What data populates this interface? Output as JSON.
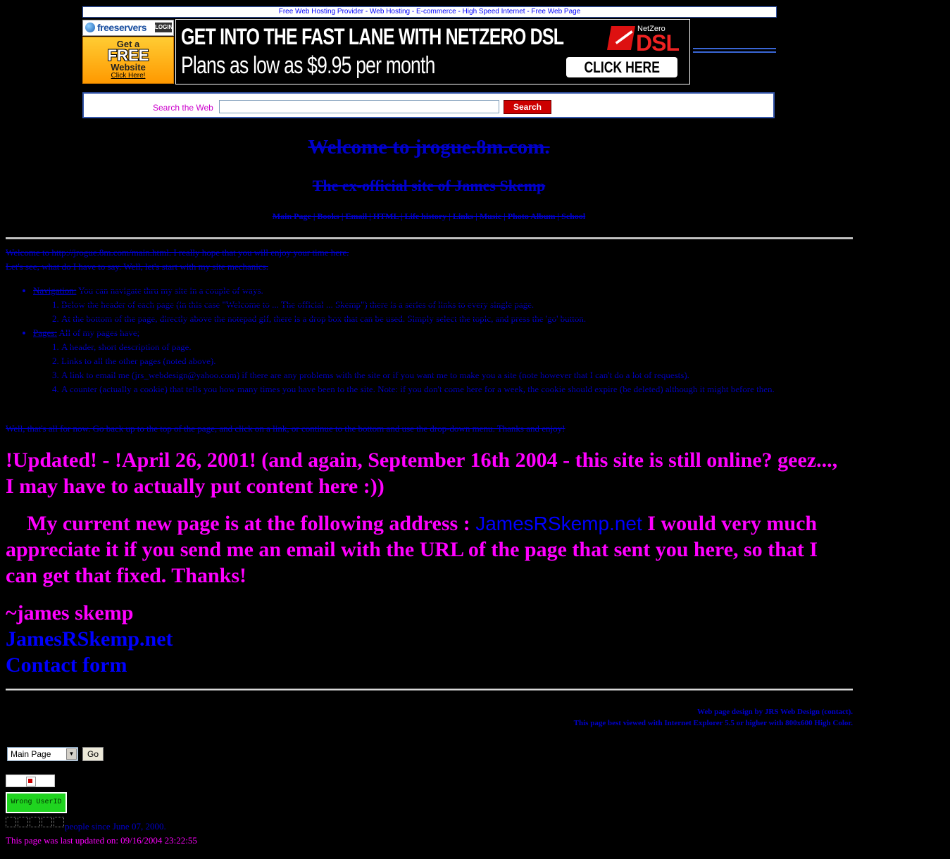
{
  "host_banner": {
    "links": [
      "Free Web Hosting Provider",
      "Web Hosting",
      "E-commerce",
      "High Speed Internet",
      "Free Web Page"
    ],
    "logo_name": "freeservers",
    "login_label": "LOGIN",
    "free_line1": "Get a",
    "free_line2": "FREE",
    "free_line3": "Website",
    "free_line4": "Click Here!"
  },
  "ad": {
    "line1": "GET INTO THE FAST LANE WITH NETZERO DSL",
    "line2": "Plans as low as $9.95 per month",
    "brand_small": "NetZero",
    "brand_big": "DSL",
    "cta": "CLICK HERE"
  },
  "search": {
    "label": "Search the Web",
    "placeholder": "",
    "button": "Search"
  },
  "header": {
    "title": "Welcome to jrogue.8m.com.",
    "subtitle": "The ex-official site of James Skemp"
  },
  "nav": [
    "Main Page",
    "Books",
    "Email",
    "HTML",
    "Life history",
    "Links",
    "Music",
    "Photo Album",
    "School"
  ],
  "intro": {
    "line1": "Welcome to http://jrogue.8m.com/main.html. I really hope that you will enjoy your time here.",
    "line2": "Let's see, what do I have to say. Well, let's start with my site mechanics."
  },
  "navigation_section": {
    "label": "Navigation:",
    "text": " You can navigate thru my site in a couple of ways.",
    "items": [
      "Below the header of each page (in this case \"Welcome to ... The official ... Skemp\") there is a series of links to every single page.",
      "At the bottom of the page, directly above the notepad gif, there is a drop box that can be used. Simply select the topic, and press the 'go' button."
    ]
  },
  "pages_section": {
    "label": "Pages:",
    "text": " All of my pages have;",
    "items": [
      "A header, short description of page.",
      "Links to all the other pages (noted above).",
      "A link to email me (jrs_webdesign@yahoo.com) if there are any problems with the site or if you want me to make you a site (note however that I can't do a lot of requests).",
      "A counter (actually a cookie) that tells you how many times you have been to the site. Note: if you don't come here for a week, the cookie should expire (be deleted) although it might before then."
    ]
  },
  "outro": "Well, that's all for now. Go back up to the top of the page, and click on a link, or continue to the bottom and use the drop-down menu. Thanks and enjoy!",
  "updated": "!Updated! - !April 26, 2001! (and again, September 16th 2004 - this site is still online? geez..., I may have to actually put content here :))",
  "current": {
    "before": "My current new page is at the following address : ",
    "link": "JamesRSkemp.net",
    "after": " I would very much appreciate it if you send me an email with the URL of the page that sent you here, so that I can get that fixed.  Thanks!"
  },
  "signature": {
    "name": "~james skemp",
    "link1": "JamesRSkemp.net",
    "link2": "Contact form"
  },
  "credits": {
    "line1_prefix": "Web page design by ",
    "line1_link": "JRS Web Design",
    "line1_suffix": " (contact).",
    "line2": "This page best viewed with Internet Explorer 5.5 or higher with 800x600 High Color."
  },
  "dropdown": {
    "selected": "Main Page",
    "go": "Go"
  },
  "wrong_userid": "Wrong UserID",
  "counter_text": "people since June 07, 2000.",
  "last_updated": "This page was last updated on: 09/16/2004 23:22:55",
  "colors": {
    "background": "#000000",
    "link_blue": "#0000cc",
    "magenta": "#ff00ff",
    "search_button": "#cc0000",
    "counter_green": "#1fd41f"
  }
}
